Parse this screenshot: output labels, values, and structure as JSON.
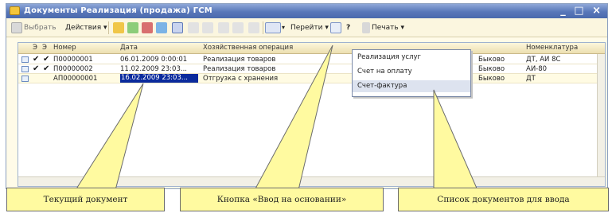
{
  "window": {
    "title": "Документы Реализация (продажа) ГСМ",
    "controls": [
      "_",
      "□",
      "×"
    ]
  },
  "toolbar": {
    "select_label": "Выбрать",
    "actions_label": "Действия ▾",
    "goto_label": "Перейти ▾",
    "help_label": "?",
    "print_label": "Печать ▾"
  },
  "table": {
    "columns": [
      "",
      "",
      "",
      "Номер",
      "Дата",
      "Хозяйственная операция",
      "",
      "Номенклатура"
    ],
    "rows": [
      {
        "number": "П00000001",
        "date": "06.01.2009 0:00:01",
        "operation": "Реализация товаров",
        "col6": "Быково",
        "nomen": "ДТ, АИ 8С",
        "posted": true,
        "checked": true
      },
      {
        "number": "П00000002",
        "date": "11.02.2009 23:03...",
        "operation": "Реализация товаров",
        "col6": "Быково",
        "nomen": "АИ-80",
        "posted": true,
        "checked": true
      },
      {
        "number": "АП00000001",
        "date": "16.02.2009 23:03...",
        "operation": "Отгрузка с хранения",
        "col6": "Быково",
        "nomen": "ДТ",
        "posted": false,
        "checked": false
      }
    ]
  },
  "dropdown": {
    "items": [
      "Реализация услуг",
      "Счет на оплату",
      "Счет-фактура"
    ],
    "highlighted_index": 2
  },
  "callouts": {
    "current_document": "Текущий документ",
    "input_basis_button": "Кнопка «Ввод на основании»",
    "input_documents_list": "Список документов для ввода"
  },
  "colors": {
    "callout_fill": "#fffaa0",
    "selection": "#0a2a9c",
    "titlebar": "#5877b9"
  }
}
